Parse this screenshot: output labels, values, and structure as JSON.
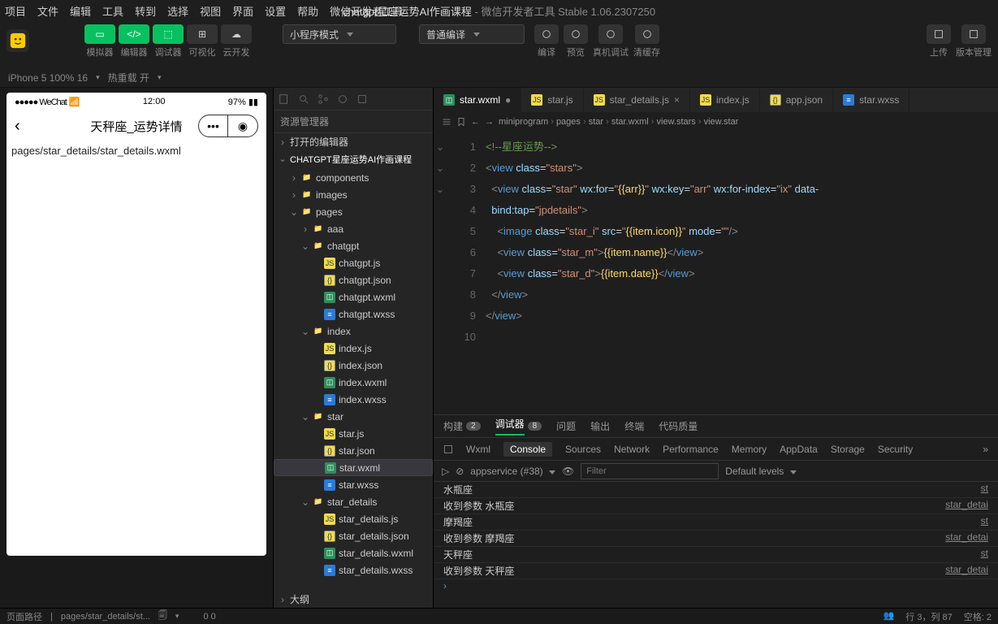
{
  "menu": [
    "项目",
    "文件",
    "编辑",
    "工具",
    "转到",
    "选择",
    "视图",
    "界面",
    "设置",
    "帮助",
    "微信开发者工具"
  ],
  "window_title": {
    "project": "chatgpt星座运势AI作画课程",
    "app": "微信开发者工具 Stable 1.06.2307250"
  },
  "toolbar": {
    "groups": [
      {
        "labels": "模拟器",
        "id": "simulator"
      },
      {
        "labels": "编辑器",
        "id": "editor"
      },
      {
        "labels": "调试器",
        "id": "debugger"
      },
      {
        "labels": "可视化",
        "id": "visual"
      },
      {
        "labels": "云开发",
        "id": "cloud"
      }
    ],
    "mode_select": "小程序模式",
    "compile_select": "普通编译",
    "actions": [
      {
        "id": "compile",
        "label": "编译"
      },
      {
        "id": "preview",
        "label": "预览"
      },
      {
        "id": "remote",
        "label": "真机调试"
      },
      {
        "id": "cache",
        "label": "清缓存"
      }
    ],
    "right": [
      {
        "id": "upload",
        "label": "上传"
      },
      {
        "id": "version",
        "label": "版本管理"
      }
    ]
  },
  "subbar": {
    "device": "iPhone 5 100% 16",
    "reload": "热重载 开"
  },
  "simulator": {
    "status_left": "●●●●● WeChat",
    "status_wifi": "wifi",
    "time": "12:00",
    "battery": "97%",
    "page_title": "天秤座_运势详情",
    "page_path": "pages/star_details/star_details.wxml"
  },
  "explorer": {
    "title": "资源管理器",
    "open_editors": "打开的编辑器",
    "project": "CHATGPT星座运势AI作画课程",
    "tree": [
      {
        "type": "folder",
        "name": "components",
        "depth": 1,
        "open": false,
        "icon": "folder"
      },
      {
        "type": "folder",
        "name": "images",
        "depth": 1,
        "open": false,
        "icon": "folder"
      },
      {
        "type": "folder",
        "name": "pages",
        "depth": 1,
        "open": true,
        "icon": "folder"
      },
      {
        "type": "folder",
        "name": "aaa",
        "depth": 2,
        "open": false,
        "icon": "folder"
      },
      {
        "type": "folder",
        "name": "chatgpt",
        "depth": 2,
        "open": true,
        "icon": "folder"
      },
      {
        "type": "file",
        "name": "chatgpt.js",
        "depth": 3,
        "icon": "js"
      },
      {
        "type": "file",
        "name": "chatgpt.json",
        "depth": 3,
        "icon": "json"
      },
      {
        "type": "file",
        "name": "chatgpt.wxml",
        "depth": 3,
        "icon": "wxml"
      },
      {
        "type": "file",
        "name": "chatgpt.wxss",
        "depth": 3,
        "icon": "wxss"
      },
      {
        "type": "folder",
        "name": "index",
        "depth": 2,
        "open": true,
        "icon": "folder"
      },
      {
        "type": "file",
        "name": "index.js",
        "depth": 3,
        "icon": "js"
      },
      {
        "type": "file",
        "name": "index.json",
        "depth": 3,
        "icon": "json"
      },
      {
        "type": "file",
        "name": "index.wxml",
        "depth": 3,
        "icon": "wxml"
      },
      {
        "type": "file",
        "name": "index.wxss",
        "depth": 3,
        "icon": "wxss"
      },
      {
        "type": "folder",
        "name": "star",
        "depth": 2,
        "open": true,
        "icon": "folder"
      },
      {
        "type": "file",
        "name": "star.js",
        "depth": 3,
        "icon": "js"
      },
      {
        "type": "file",
        "name": "star.json",
        "depth": 3,
        "icon": "json"
      },
      {
        "type": "file",
        "name": "star.wxml",
        "depth": 3,
        "icon": "wxml",
        "active": true
      },
      {
        "type": "file",
        "name": "star.wxss",
        "depth": 3,
        "icon": "wxss"
      },
      {
        "type": "folder",
        "name": "star_details",
        "depth": 2,
        "open": true,
        "icon": "folder"
      },
      {
        "type": "file",
        "name": "star_details.js",
        "depth": 3,
        "icon": "js"
      },
      {
        "type": "file",
        "name": "star_details.json",
        "depth": 3,
        "icon": "json"
      },
      {
        "type": "file",
        "name": "star_details.wxml",
        "depth": 3,
        "icon": "wxml"
      },
      {
        "type": "file",
        "name": "star_details.wxss",
        "depth": 3,
        "icon": "wxss"
      }
    ],
    "outline": "大纲"
  },
  "tabs": [
    {
      "name": "star.wxml",
      "icon": "wxml",
      "active": true,
      "dirty": true
    },
    {
      "name": "star.js",
      "icon": "js"
    },
    {
      "name": "star_details.js",
      "icon": "js",
      "close": true
    },
    {
      "name": "index.js",
      "icon": "js"
    },
    {
      "name": "app.json",
      "icon": "json"
    },
    {
      "name": "star.wxss",
      "icon": "wxss"
    }
  ],
  "breadcrumb": [
    "miniprogram",
    "pages",
    "star",
    "star.wxml",
    "view.stars",
    "view.star"
  ],
  "code": {
    "lines": [
      {
        "n": 1,
        "html": "<span class='c-comment'>&lt;!--星座运势--&gt;</span>"
      },
      {
        "n": 2,
        "html": "<span class='c-punct'>&lt;</span><span class='c-tag'>view</span> <span class='c-attr'>class</span>=<span class='c-str'>\"stars\"</span><span class='c-punct'>&gt;</span>"
      },
      {
        "n": 3,
        "html": "  <span class='c-punct'>&lt;</span><span class='c-tag'>view</span> <span class='c-attr'>class</span>=<span class='c-str'>\"star\"</span> <span class='c-attr'>wx:for</span>=<span class='c-str'>\"</span><span class='c-brace'>{{arr}}</span><span class='c-str'>\"</span> <span class='c-attr'>wx:key</span>=<span class='c-str'>\"arr\"</span> <span class='c-attr'>wx:for-index</span>=<span class='c-str'>\"ix\"</span> <span class='c-attr'>data-</span>"
      },
      {
        "n": "",
        "html": "  <span class='c-attr'>bind:tap</span>=<span class='c-str'>\"jpdetails\"</span><span class='c-punct'>&gt;</span>"
      },
      {
        "n": 4,
        "html": "    <span class='c-punct'>&lt;</span><span class='c-tag'>image</span> <span class='c-attr'>class</span>=<span class='c-str'>\"star_i\"</span> <span class='c-attr'>src</span>=<span class='c-str'>\"</span><span class='c-brace'>{{item.icon}}</span><span class='c-str'>\"</span> <span class='c-attr'>mode</span>=<span class='c-str'>\"\"</span><span class='c-punct'>/&gt;</span>"
      },
      {
        "n": 5,
        "html": "    <span class='c-punct'>&lt;</span><span class='c-tag'>view</span> <span class='c-attr'>class</span>=<span class='c-str'>\"star_m\"</span><span class='c-punct'>&gt;</span><span class='c-brace'>{{item.name}}</span><span class='c-punct'>&lt;/</span><span class='c-tag'>view</span><span class='c-punct'>&gt;</span>"
      },
      {
        "n": 6,
        "html": "    <span class='c-punct'>&lt;</span><span class='c-tag'>view</span> <span class='c-attr'>class</span>=<span class='c-str'>\"star_d\"</span><span class='c-punct'>&gt;</span><span class='c-brace'>{{item.date}}</span><span class='c-punct'>&lt;/</span><span class='c-tag'>view</span><span class='c-punct'>&gt;</span>"
      },
      {
        "n": 7,
        "html": "  <span class='c-punct'>&lt;/</span><span class='c-tag'>view</span><span class='c-punct'>&gt;</span>"
      },
      {
        "n": 8,
        "html": "<span class='c-punct'>&lt;/</span><span class='c-tag'>view</span><span class='c-punct'>&gt;</span>"
      },
      {
        "n": 9,
        "html": ""
      },
      {
        "n": 10,
        "html": ""
      }
    ]
  },
  "panel": {
    "top_tabs": [
      {
        "label": "构建",
        "badge": "2"
      },
      {
        "label": "调试器",
        "badge": "8",
        "active": true
      },
      {
        "label": "问题"
      },
      {
        "label": "输出"
      },
      {
        "label": "终端"
      },
      {
        "label": "代码质量"
      }
    ],
    "dev_tabs": [
      "Wxml",
      "Console",
      "Sources",
      "Network",
      "Performance",
      "Memory",
      "AppData",
      "Storage",
      "Security"
    ],
    "dev_active": "Console",
    "context": "appservice (#38)",
    "filter_placeholder": "Filter",
    "levels": "Default levels",
    "logs": [
      {
        "msg": "水瓶座",
        "src": "st"
      },
      {
        "msg": "收到参数 水瓶座",
        "src": "star_detai"
      },
      {
        "msg": "摩羯座",
        "src": "st"
      },
      {
        "msg": "收到参数 摩羯座",
        "src": "star_detai"
      },
      {
        "msg": "天秤座",
        "src": "st"
      },
      {
        "msg": "收到参数 天秤座",
        "src": "star_detai"
      }
    ],
    "prompt": "›"
  },
  "statusbar": {
    "path_label": "页面路径",
    "path": "pages/star_details/st...",
    "cursor": "行 3，列 87",
    "spaces": "空格: 2",
    "zeros": "0   0"
  }
}
